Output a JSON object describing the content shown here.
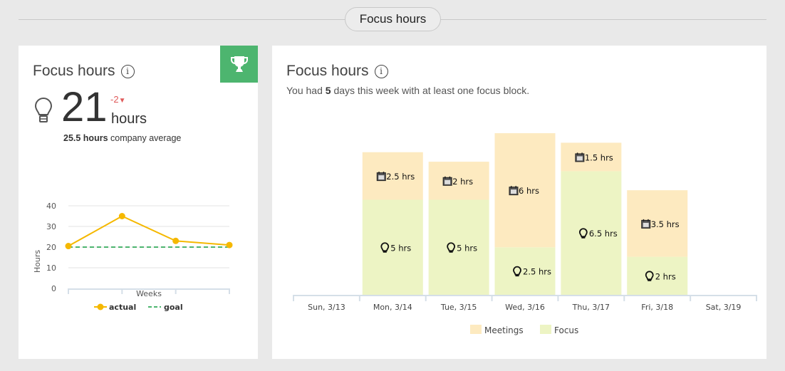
{
  "section": {
    "label": "Focus hours"
  },
  "summary_card": {
    "title": "Focus hours",
    "info_icon": "info-icon",
    "badge_icon": "trophy-icon",
    "badge_color": "#4db56f",
    "icon": "lightbulb-icon",
    "value": "21",
    "unit": "hours",
    "delta": "-2",
    "delta_direction": "down",
    "delta_color": "#e05a5a",
    "company_avg_value": "25.5 hours",
    "company_avg_label": "company average"
  },
  "detail_card": {
    "title": "Focus hours",
    "info_icon": "info-icon",
    "subtitle_prefix": "You had",
    "subtitle_count": "5",
    "subtitle_suffix": "days this week with at least one focus block."
  },
  "chart_data": [
    {
      "type": "line",
      "title": "",
      "xlabel": "Weeks",
      "ylabel": "Hours",
      "ylim": [
        0,
        40
      ],
      "yticks": [
        0,
        10,
        20,
        30,
        40
      ],
      "x": [
        1,
        2,
        3,
        4
      ],
      "grid": true,
      "legend": "bottom",
      "series": [
        {
          "name": "actual",
          "values": [
            20.5,
            35,
            23,
            21
          ],
          "color": "#f5b800",
          "style": "solid-markers"
        },
        {
          "name": "goal",
          "values": [
            20,
            20,
            20,
            20
          ],
          "color": "#4db56f",
          "style": "dashed"
        }
      ]
    },
    {
      "type": "bar",
      "stacked": true,
      "title": "",
      "categories": [
        "Sun, 3/13",
        "Mon, 3/14",
        "Tue, 3/15",
        "Wed, 3/16",
        "Thu, 3/17",
        "Fri, 3/18",
        "Sat, 3/19"
      ],
      "legend": "bottom",
      "unit": "hrs",
      "series": [
        {
          "name": "Focus",
          "color": "#edf4c4",
          "icon": "lightbulb-icon",
          "values": [
            0,
            5,
            5,
            2.5,
            6.5,
            2,
            0
          ]
        },
        {
          "name": "Meetings",
          "color": "#fdeac0",
          "icon": "calendar-icon",
          "values": [
            0,
            2.5,
            2,
            6,
            1.5,
            3.5,
            0
          ]
        }
      ]
    }
  ]
}
